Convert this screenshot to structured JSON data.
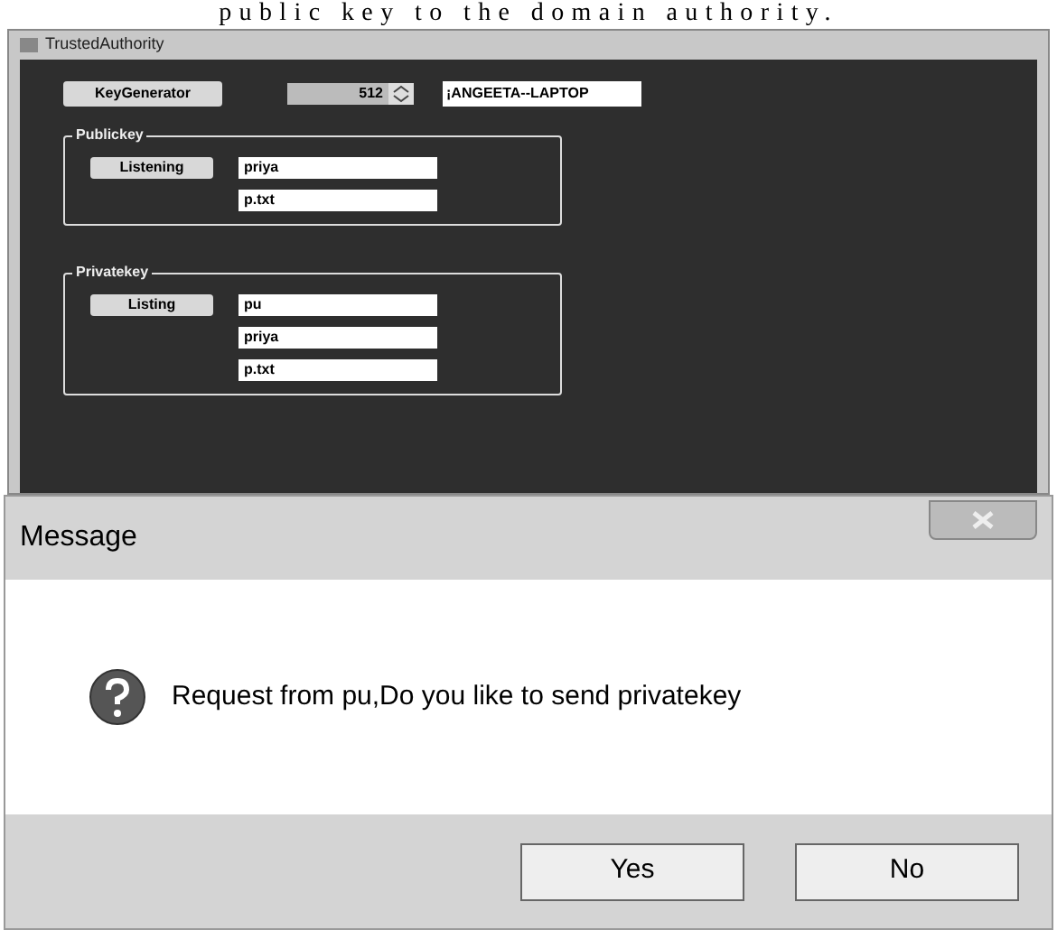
{
  "caption": "public key to the domain authority.",
  "window": {
    "title": "TrustedAuthority"
  },
  "toolbar": {
    "button": "KeyGenerator",
    "spinner_value": "512",
    "host_field": "¡ANGEETA--LAPTOP"
  },
  "groups": [
    {
      "title": "Publickey",
      "button": "Listening",
      "fields": [
        "priya",
        "p.txt"
      ]
    },
    {
      "title": "Privatekey",
      "button": "Listing",
      "fields": [
        "pu",
        "priya",
        "p.txt"
      ]
    }
  ],
  "dialog": {
    "title": "Message",
    "message": "Request from pu,Do you like to send privatekey",
    "buttons": [
      "Yes",
      "No"
    ]
  }
}
